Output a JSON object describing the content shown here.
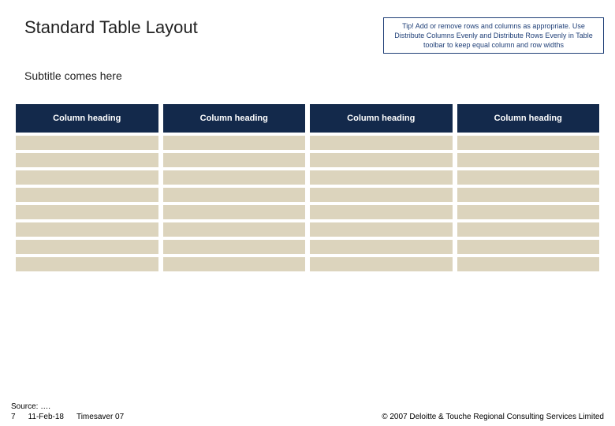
{
  "header": {
    "title": "Standard Table Layout",
    "tip": "Tip! Add or remove rows and columns as appropriate. Use Distribute Columns Evenly and Distribute Rows Evenly in Table toolbar to keep equal column and row widths"
  },
  "subtitle": "Subtitle comes here",
  "table": {
    "columns": [
      "Column heading",
      "Column heading",
      "Column heading",
      "Column heading"
    ],
    "rows": [
      [
        "",
        "",
        "",
        ""
      ],
      [
        "",
        "",
        "",
        ""
      ],
      [
        "",
        "",
        "",
        ""
      ],
      [
        "",
        "",
        "",
        ""
      ],
      [
        "",
        "",
        "",
        ""
      ],
      [
        "",
        "",
        "",
        ""
      ],
      [
        "",
        "",
        "",
        ""
      ],
      [
        "",
        "",
        "",
        ""
      ]
    ]
  },
  "footer": {
    "source_label": "Source: ….",
    "page_number": "7",
    "date": "11-Feb-18",
    "doc_title": "Timesaver 07",
    "copyright": "© 2007 Deloitte & Touche Regional Consulting Services Limited"
  }
}
